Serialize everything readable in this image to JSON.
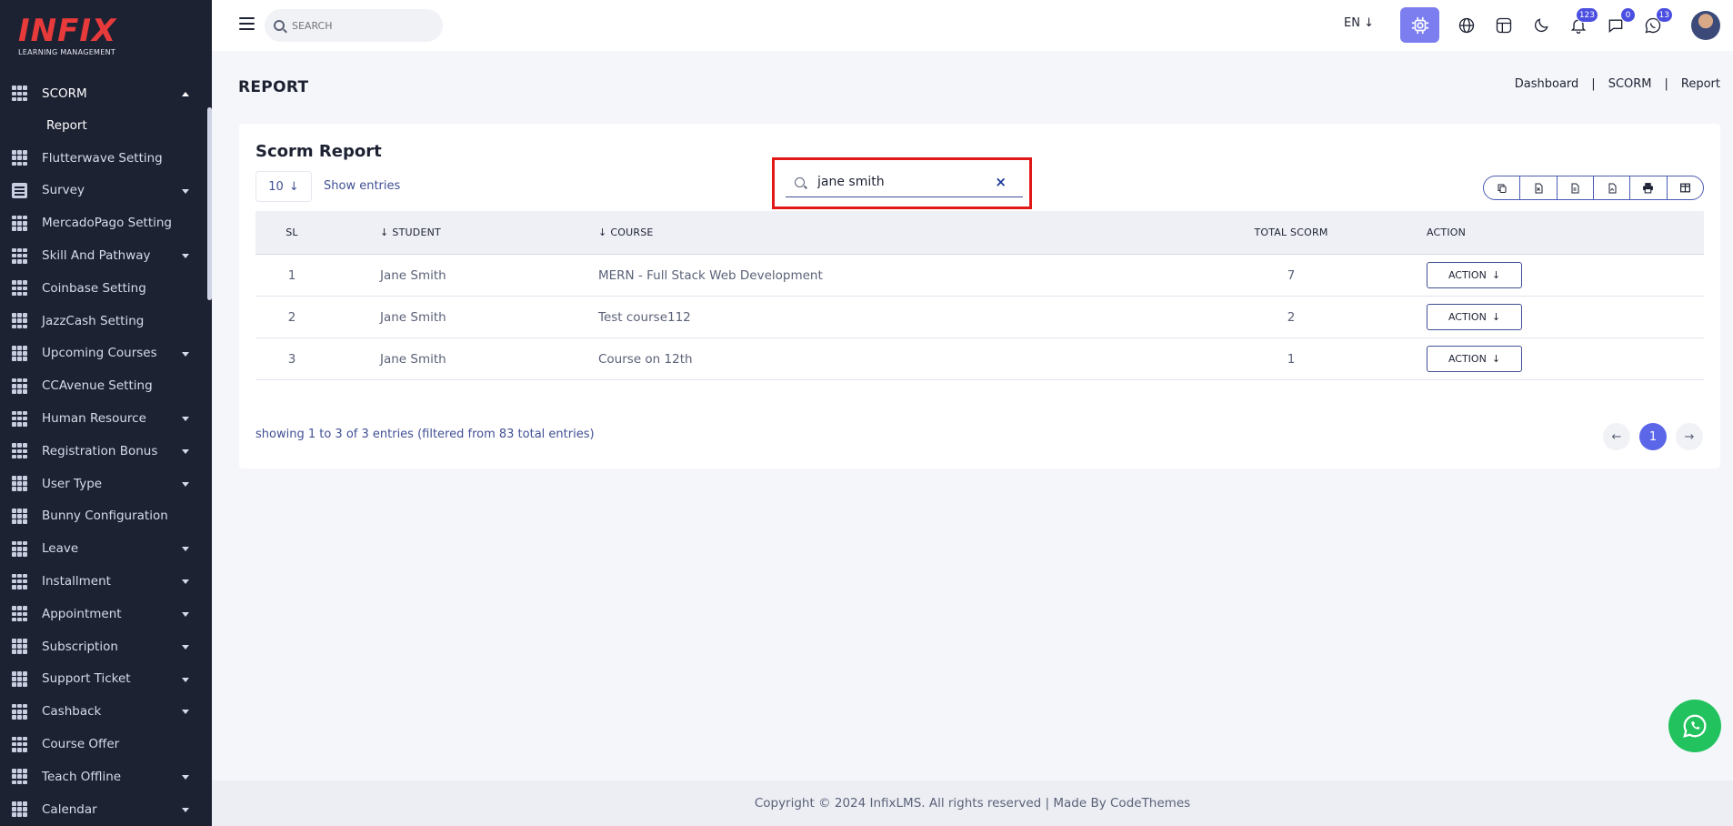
{
  "brand": {
    "name": "INFIX",
    "tagline": "LEARNING MANAGEMENT"
  },
  "sidebar": {
    "items": [
      {
        "label": "SCORM",
        "icon": "grid-icon",
        "expanded": true,
        "sub": [
          "Report"
        ]
      },
      {
        "label": "Flutterwave Setting",
        "icon": "grid-icon",
        "caret": false
      },
      {
        "label": "Survey",
        "icon": "document-icon",
        "caret": true
      },
      {
        "label": "MercadoPago Setting",
        "icon": "grid-icon",
        "caret": false
      },
      {
        "label": "Skill And Pathway",
        "icon": "grid-icon",
        "caret": true
      },
      {
        "label": "Coinbase Setting",
        "icon": "grid-icon",
        "caret": false
      },
      {
        "label": "JazzCash Setting",
        "icon": "grid-icon",
        "caret": false
      },
      {
        "label": "Upcoming Courses",
        "icon": "grid-icon",
        "caret": true
      },
      {
        "label": "CCAvenue Setting",
        "icon": "grid-icon",
        "caret": false
      },
      {
        "label": "Human Resource",
        "icon": "grid-icon",
        "caret": true
      },
      {
        "label": "Registration Bonus",
        "icon": "grid-icon",
        "caret": true
      },
      {
        "label": "User Type",
        "icon": "grid-icon",
        "caret": true
      },
      {
        "label": "Bunny Configuration",
        "icon": "grid-icon",
        "caret": false
      },
      {
        "label": "Leave",
        "icon": "grid-icon",
        "caret": true
      },
      {
        "label": "Installment",
        "icon": "grid-icon",
        "caret": true
      },
      {
        "label": "Appointment",
        "icon": "grid-icon",
        "caret": true
      },
      {
        "label": "Subscription",
        "icon": "grid-icon",
        "caret": true
      },
      {
        "label": "Support Ticket",
        "icon": "grid-icon",
        "caret": true
      },
      {
        "label": "Cashback",
        "icon": "grid-icon",
        "caret": true
      },
      {
        "label": "Course Offer",
        "icon": "grid-icon",
        "caret": false
      },
      {
        "label": "Teach Offline",
        "icon": "grid-icon",
        "caret": true
      },
      {
        "label": "Calendar",
        "icon": "grid-icon",
        "caret": true
      }
    ]
  },
  "topbar": {
    "search_placeholder": "SEARCH",
    "language": "EN",
    "notifications_count": "123",
    "messages_count": "0",
    "chats_count": "13"
  },
  "page": {
    "title": "REPORT",
    "breadcrumb": [
      "Dashboard",
      "SCORM",
      "Report"
    ]
  },
  "card": {
    "title": "Scorm Report",
    "entries_value": "10",
    "show_entries_label": "Show entries",
    "filter_value": "jane smith",
    "columns": [
      "SL",
      "STUDENT",
      "COURSE",
      "TOTAL SCORM",
      "ACTION"
    ],
    "rows": [
      {
        "sl": "1",
        "student": "Jane Smith",
        "course": "MERN - Full Stack Web Development",
        "total": "7",
        "action": "ACTION"
      },
      {
        "sl": "2",
        "student": "Jane Smith",
        "course": "Test course112",
        "total": "2",
        "action": "ACTION"
      },
      {
        "sl": "3",
        "student": "Jane Smith",
        "course": "Course on 12th",
        "total": "1",
        "action": "ACTION"
      }
    ],
    "showing_text": "showing 1 to 3 of 3 entries (filtered from 83 total entries)",
    "current_page": "1"
  },
  "footer": {
    "text": "Copyright © 2024 InfixLMS. All rights reserved | Made By CodeThemes"
  },
  "colors": {
    "sidebar_bg": "#1d2233",
    "accent": "#5c66e8",
    "highlight_border": "#e11818",
    "whatsapp": "#22c35e"
  }
}
